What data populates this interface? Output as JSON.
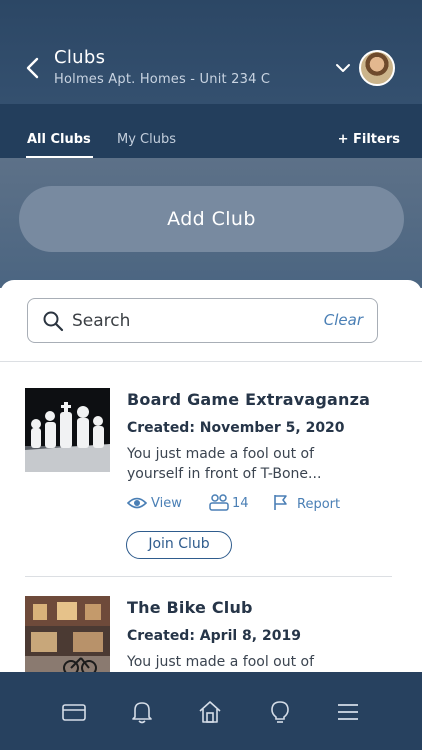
{
  "header": {
    "title": "Clubs",
    "subtitle": "Holmes Apt. Homes - Unit 234 C",
    "back_icon": "chevron-left-icon",
    "dropdown_icon": "chevron-down-icon"
  },
  "tabs": {
    "items": [
      {
        "label": "All Clubs",
        "active": true
      },
      {
        "label": "My Clubs",
        "active": false
      }
    ],
    "filters_label": "+ Filters"
  },
  "add_club_label": "Add Club",
  "search": {
    "placeholder": "Search",
    "clear_label": "Clear"
  },
  "clubs": [
    {
      "name": "Board Game Extravaganza",
      "created": "Created: November 5, 2020",
      "description": "You just made a fool out of yourself in front of T-Bone...",
      "view_label": "View",
      "members": "14",
      "report_label": "Report",
      "join_label": "Join Club"
    },
    {
      "name": "The Bike Club",
      "created": "Created: April 8, 2019",
      "description": "You just made a fool out of"
    }
  ],
  "bottom_nav": [
    {
      "icon": "card-icon"
    },
    {
      "icon": "bell-icon"
    },
    {
      "icon": "home-icon"
    },
    {
      "icon": "lightbulb-icon"
    },
    {
      "icon": "menu-icon"
    }
  ],
  "colors": {
    "header_bg": "#2c4765",
    "tab_bar_bg": "#233e5c",
    "accent_link": "#4a7fb5",
    "nav_bg": "#27415f"
  }
}
